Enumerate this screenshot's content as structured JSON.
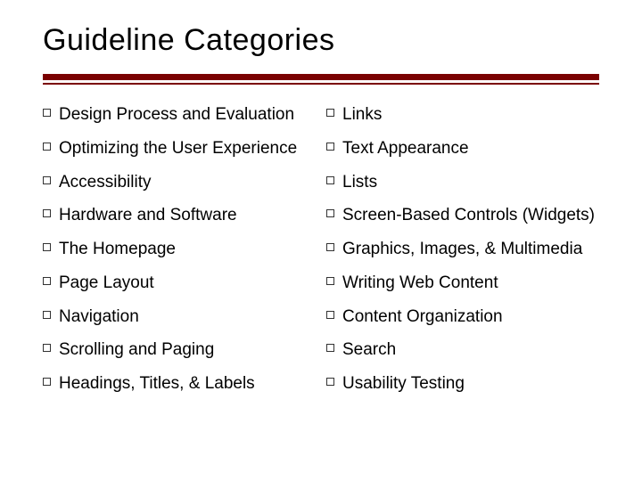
{
  "title": "Guideline Categories",
  "left": [
    "Design Process and Evaluation",
    "Optimizing the User Experience",
    "Accessibility",
    "Hardware and Software",
    "The Homepage",
    "Page Layout",
    "Navigation",
    "Scrolling and Paging",
    "Headings, Titles, & Labels"
  ],
  "right": [
    "Links",
    "Text Appearance",
    "Lists",
    "Screen-Based Controls (Widgets)",
    "Graphics, Images, & Multimedia",
    "Writing Web Content",
    "Content Organization",
    "Search",
    "Usability Testing"
  ]
}
